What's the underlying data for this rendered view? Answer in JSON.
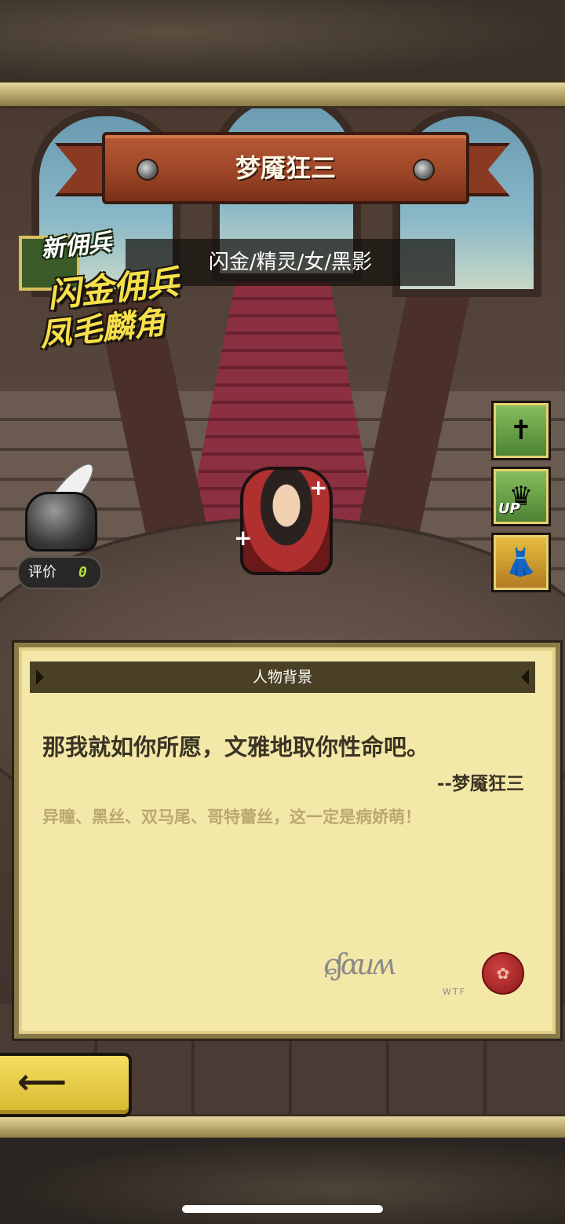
{
  "character": {
    "name": "梦魇狂三",
    "tags": "闪金/精灵/女/黑影"
  },
  "promo": {
    "new_label": "新佣兵",
    "line1": "闪金佣兵",
    "line2": "凤毛麟角"
  },
  "rating": {
    "label": "评价",
    "value": "0"
  },
  "side_buttons": [
    {
      "icon": "cross-icon"
    },
    {
      "icon": "crown-up-icon",
      "text": "UP"
    },
    {
      "icon": "dress-icon"
    }
  ],
  "background_panel": {
    "title": "人物背景",
    "quote": "那我就如你所愿，文雅地取你性命吧。",
    "quote_author": "--梦魇狂三",
    "description": "异瞳、黑丝、双马尾、哥特蕾丝，这一定是病娇萌！",
    "signature_small": "WTF"
  },
  "back_button": {
    "icon": "back-arrow-icon"
  },
  "colors": {
    "banner": "#9a4426",
    "panel": "#f4e8a8",
    "promo_text": "#f6e04a",
    "rating_value": "#b8e040",
    "back_button": "#f4de60"
  }
}
